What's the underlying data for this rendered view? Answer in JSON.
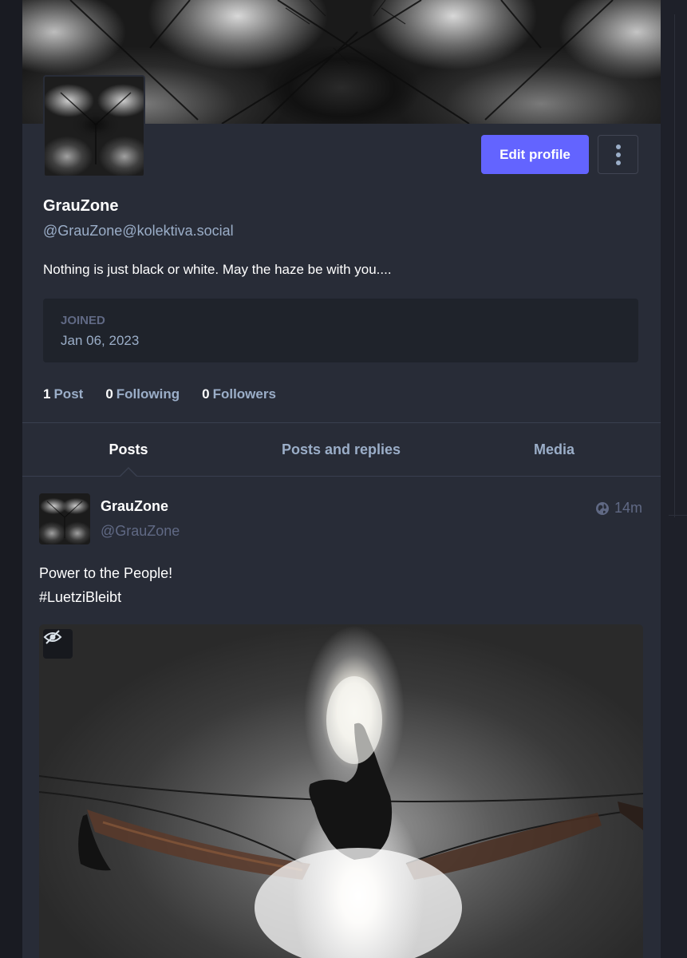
{
  "profile": {
    "display_name": "GrauZone",
    "acct": "@GrauZone@kolektiva.social",
    "bio": "Nothing is just black or white. May the haze be with you....",
    "edit_profile_label": "Edit profile",
    "joined_label": "JOINED",
    "joined_value": "Jan 06, 2023",
    "counts": {
      "posts_num": "1",
      "posts_label": "Post",
      "following_num": "0",
      "following_label": "Following",
      "followers_num": "0",
      "followers_label": "Followers"
    }
  },
  "tabs": [
    {
      "label": "Posts",
      "active": true
    },
    {
      "label": "Posts and replies",
      "active": false
    },
    {
      "label": "Media",
      "active": false
    }
  ],
  "status": {
    "display_name": "GrauZone",
    "acct": "@GrauZone",
    "time": "14m",
    "visibility_icon": "globe-icon",
    "text_lines": [
      "Power to the People!",
      "#LuetziBleibt"
    ],
    "media_toggle_icon": "eye-slash-icon"
  },
  "colors": {
    "accent": "#6364ff",
    "background": "#282c37",
    "muted_text": "#9baec8",
    "dim_text": "#606984"
  }
}
